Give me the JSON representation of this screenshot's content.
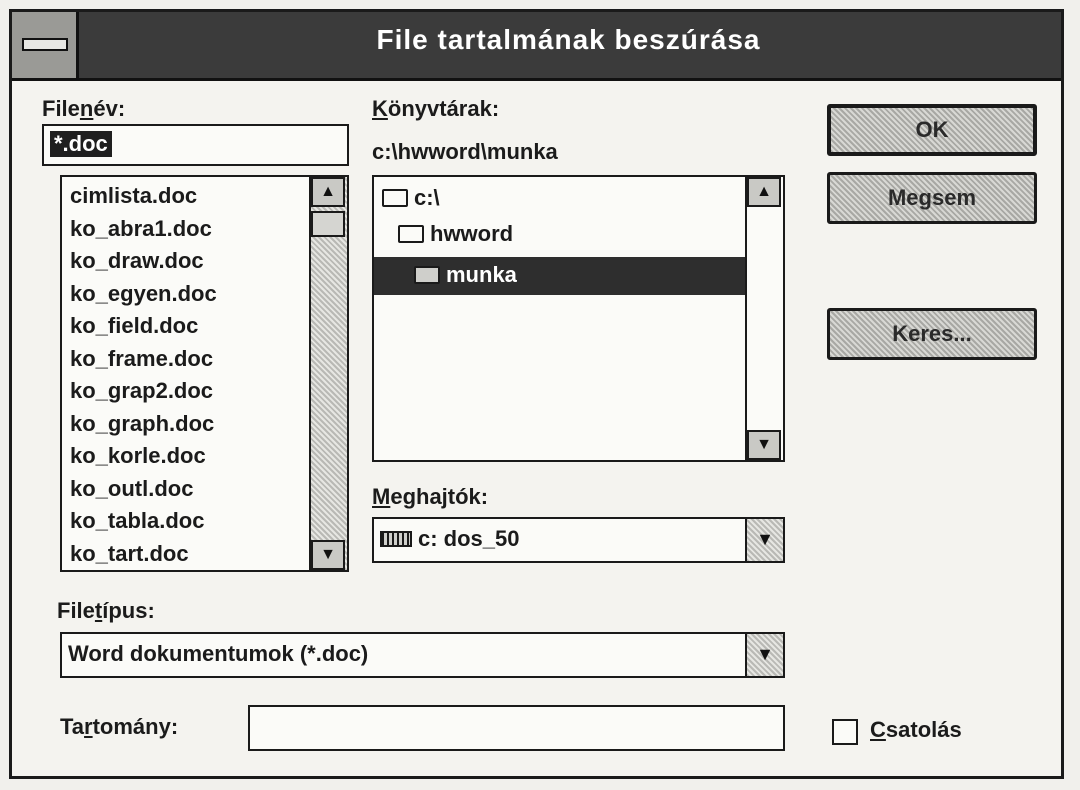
{
  "title": "File tartalmának beszúrása",
  "filename": {
    "label_pre": "File",
    "label_u": "n",
    "label_post": "év:",
    "value": "*.doc",
    "files": [
      "cimlista.doc",
      "ko_abra1.doc",
      "ko_draw.doc",
      "ko_egyen.doc",
      "ko_field.doc",
      "ko_frame.doc",
      "ko_grap2.doc",
      "ko_graph.doc",
      "ko_korle.doc",
      "ko_outl.doc",
      "ko_tabla.doc",
      "ko_tart.doc"
    ]
  },
  "directories": {
    "label_u": "K",
    "label_post": "önyvtárak:",
    "current_path": "c:\\hwword\\munka",
    "items": [
      "c:\\",
      "hwword",
      "munka"
    ],
    "selected": "munka"
  },
  "drives": {
    "label_u": "M",
    "label_post": "eghajtók:",
    "value": "c: dos_50"
  },
  "filetype": {
    "label_pre": "File",
    "label_u": "t",
    "label_post": "ípus:",
    "value": "Word dokumentumok (*.doc)"
  },
  "range": {
    "label_pre": "Ta",
    "label_u": "r",
    "label_post": "tomány:",
    "value": ""
  },
  "link": {
    "label_u": "C",
    "label_post": "satolás",
    "checked": false
  },
  "buttons": {
    "ok": "OK",
    "cancel": "Megsem",
    "find": "Keres..."
  },
  "icons": {
    "sysmenu": "system-menu-icon",
    "folder_open": "open-folder-icon",
    "drive": "hard-drive-icon",
    "scroll_up": "scroll-up-arrow-icon",
    "scroll_down": "scroll-down-arrow-icon",
    "dropdown": "dropdown-arrow-icon"
  }
}
